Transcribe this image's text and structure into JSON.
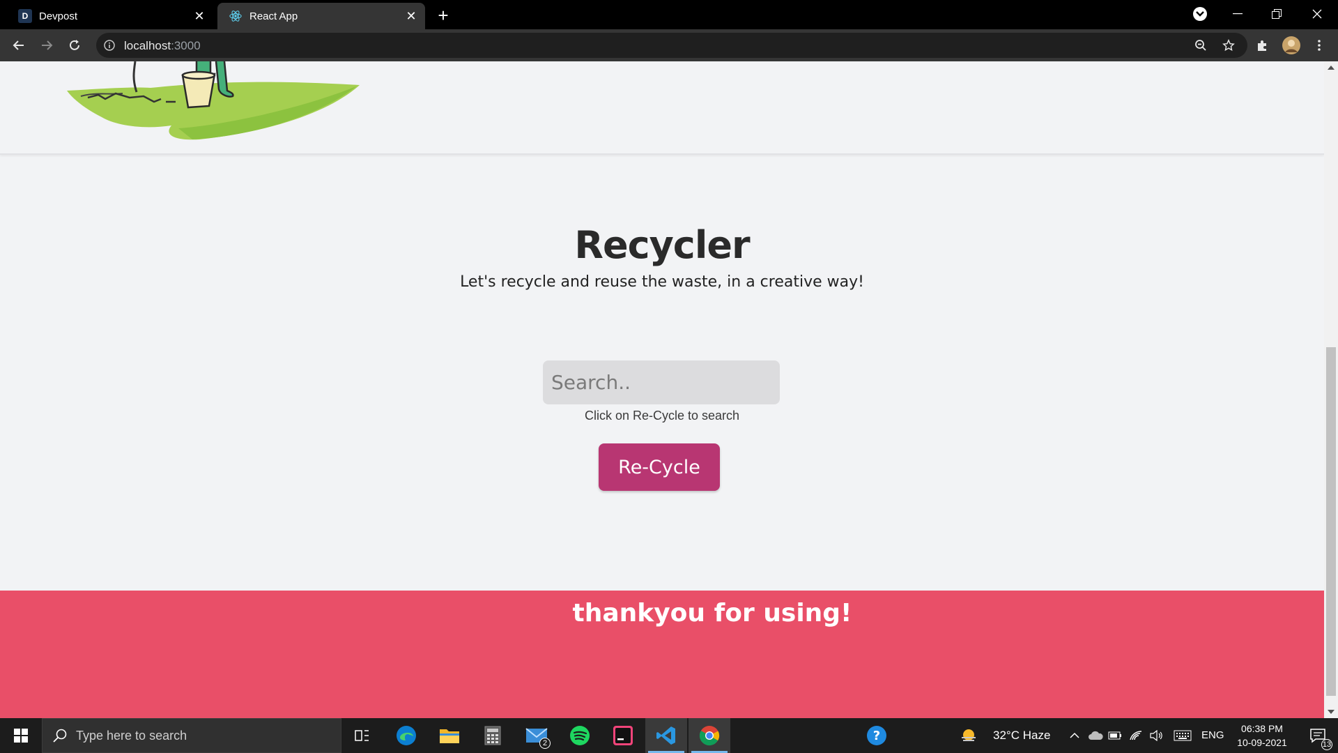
{
  "browser": {
    "tabs": [
      {
        "title": "Devpost",
        "favicon": "D",
        "active": false
      },
      {
        "title": "React App",
        "active": true
      }
    ],
    "url_host": "localhost",
    "url_port": ":3000"
  },
  "page": {
    "headline": "Recycler",
    "tagline": "Let's recycle and reuse the waste, in a creative way!",
    "search_placeholder": "Search..",
    "search_hint": "Click on Re-Cycle to search",
    "recycle_button": "Re-Cycle",
    "footer_text": "thankyou for using!"
  },
  "taskbar": {
    "search_placeholder": "Type here to search",
    "mail_badge": "2",
    "weather": "32°C  Haze",
    "language": "ENG",
    "time": "06:38 PM",
    "date": "10-09-2021",
    "notification_count": "13"
  },
  "colors": {
    "button": "#b83672",
    "footer": "#e94f68",
    "background": "#f2f3f5"
  }
}
